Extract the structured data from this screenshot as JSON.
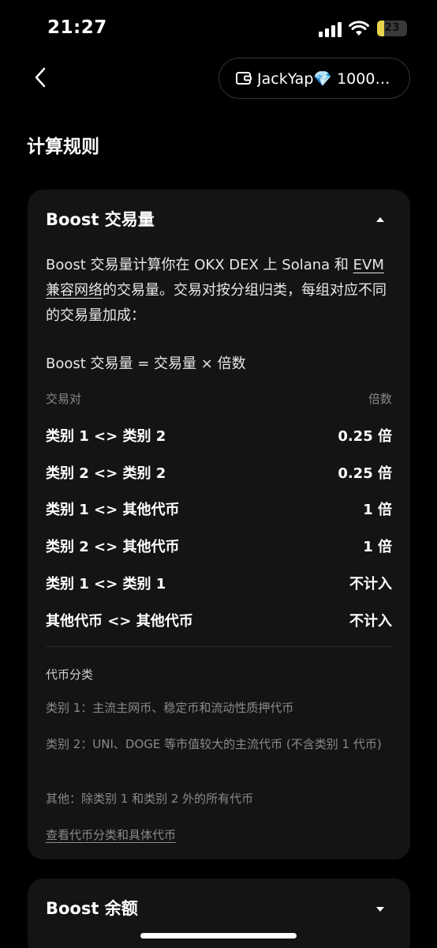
{
  "status_bar": {
    "time": "21:27",
    "battery": "23",
    "battery_level": 0.23,
    "battery_color": "#e8d44d",
    "icons": [
      "signal-icon",
      "wifi-icon",
      "battery-icon"
    ]
  },
  "nav": {
    "back_icon": "chevron-left-icon",
    "wallet_icon": "wallet-icon",
    "wallet_label": "JackYap💎 1000…"
  },
  "page_title": "计算规则",
  "boost_volume": {
    "header": "Boost 交易量",
    "description": {
      "part1": "Boost 交易量计算你在 OKX DEX 上 Solana 和 ",
      "link": "EVM 兼容网络",
      "part2": "的交易量。交易对按分组归类，每组对应不同的交易量加成："
    },
    "formula": "Boost 交易量 = 交易量 × 倍数",
    "table": {
      "headers": {
        "pair": "交易对",
        "multiplier": "倍数"
      },
      "rows": [
        {
          "pair": "类别 1 <> 类别 2",
          "multiplier": "0.25 倍"
        },
        {
          "pair": "类别 2 <> 类别 2",
          "multiplier": "0.25 倍"
        },
        {
          "pair": "类别 1 <> 其他代币",
          "multiplier": "1 倍"
        },
        {
          "pair": "类别 2 <> 其他代币",
          "multiplier": "1 倍"
        },
        {
          "pair": "类别 1 <> 类别 1",
          "multiplier": "不计入"
        },
        {
          "pair": "其他代币 <> 其他代币",
          "multiplier": "不计入"
        }
      ]
    },
    "categories": {
      "title": "代币分类",
      "items": [
        "类别 1：主流主网币、稳定币和流动性质押代币",
        "类别 2：UNI、DOGE 等市值较大的主流代币 (不含类别 1 代币)",
        "其他：除类别 1 和类别 2 外的所有代币"
      ],
      "link": "查看代币分类和具体代币"
    }
  },
  "boost_balance": {
    "header": "Boost 余额"
  }
}
